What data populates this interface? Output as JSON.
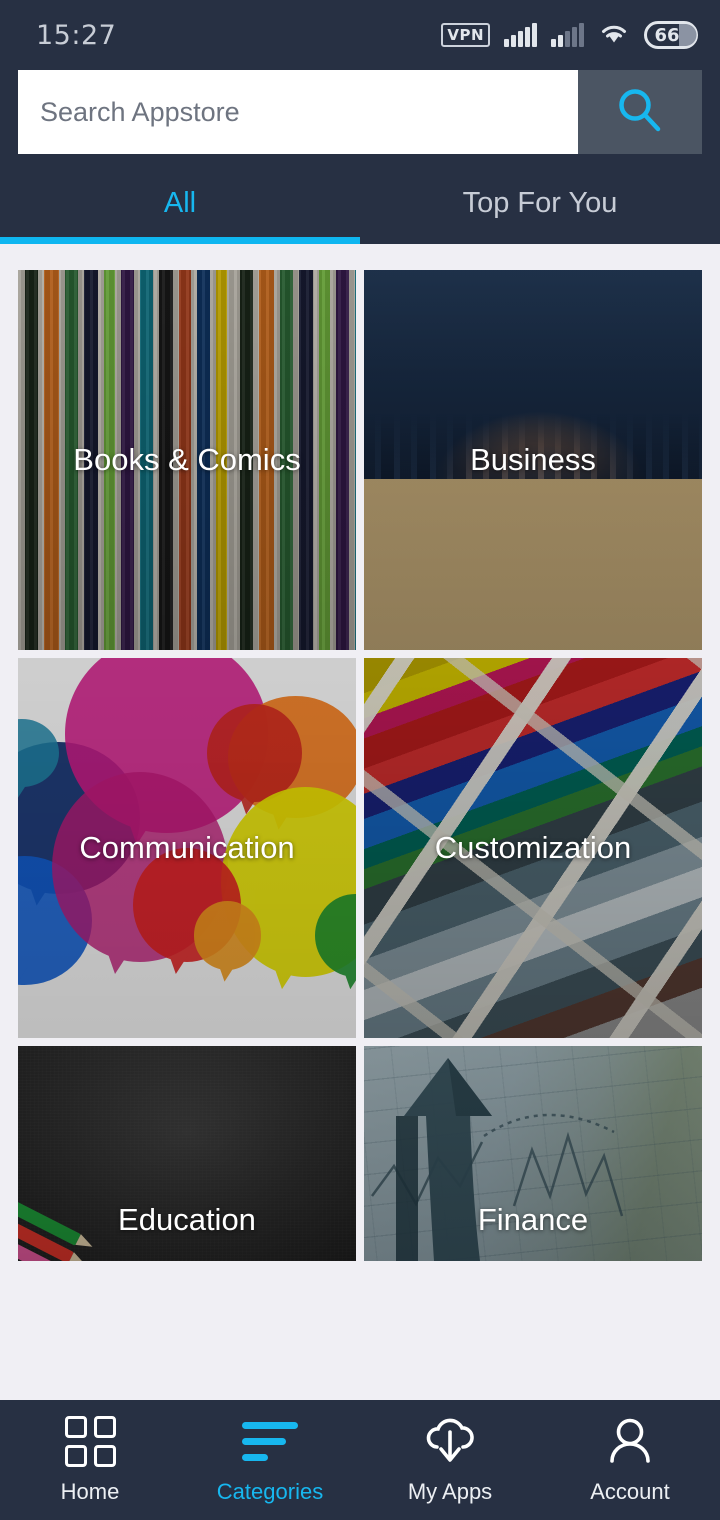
{
  "statusbar": {
    "time": "15:27",
    "vpn_label": "VPN",
    "battery": "66",
    "icons": [
      "vpn-badge",
      "signal-icon",
      "signal-icon-secondary",
      "wifi-icon",
      "battery-icon"
    ]
  },
  "search": {
    "placeholder": "Search Appstore",
    "value": "",
    "button_icon": "search-icon"
  },
  "tabs": {
    "items": [
      {
        "label": "All",
        "active": true
      },
      {
        "label": "Top For You",
        "active": false
      }
    ]
  },
  "categories": [
    {
      "label": "Books & Comics",
      "art": "comic-spines"
    },
    {
      "label": "Business",
      "art": "handshake-skyline"
    },
    {
      "label": "Communication",
      "art": "speech-bubbles"
    },
    {
      "label": "Customization",
      "art": "color-swatches"
    },
    {
      "label": "Education",
      "art": "chalkboard-pencils"
    },
    {
      "label": "Finance",
      "art": "growth-arrow-charts"
    }
  ],
  "bottomnav": {
    "items": [
      {
        "label": "Home",
        "icon": "grid-icon",
        "active": false
      },
      {
        "label": "Categories",
        "icon": "list-lines-icon",
        "active": true
      },
      {
        "label": "My Apps",
        "icon": "cloud-download-icon",
        "active": false
      },
      {
        "label": "Account",
        "icon": "person-icon",
        "active": false
      }
    ]
  },
  "colors": {
    "header_bg": "#273043",
    "accent": "#17b7ef",
    "page_bg": "#f0eff4",
    "search_button_bg": "#4b5563",
    "nav_bg": "#273043"
  }
}
